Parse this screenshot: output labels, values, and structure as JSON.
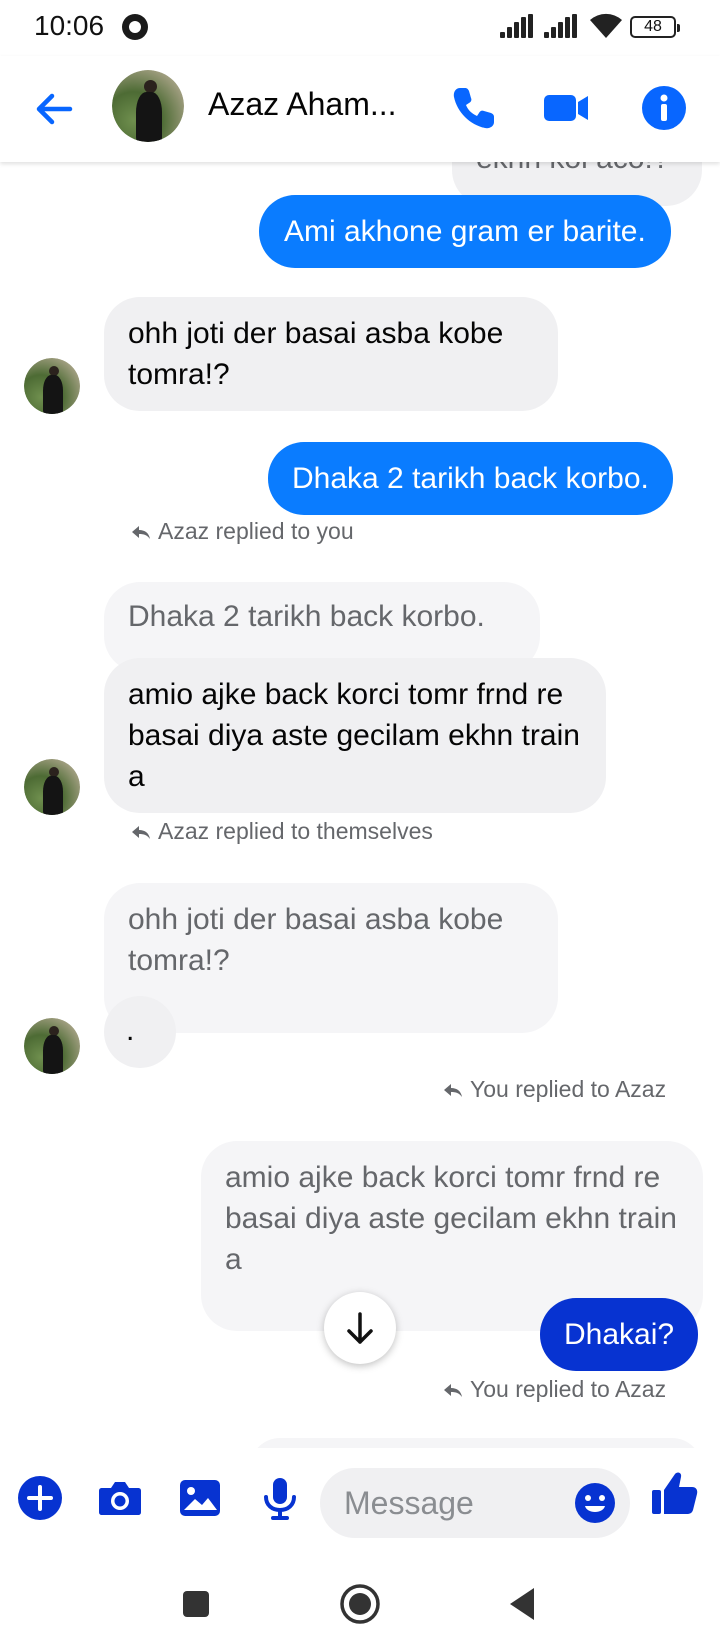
{
  "status_bar": {
    "time": "10:06",
    "battery": "48"
  },
  "header": {
    "contact_name": "Azaz Aham..."
  },
  "chat": {
    "partial_top_text": "ekhn koi aco!?",
    "messages": {
      "m1": "Ami akhone gram er barite.",
      "m2": "ohh joti der basai asba kobe tomra!?",
      "m3": "Dhaka 2 tarikh back korbo.",
      "r1_label": "Azaz replied to you",
      "r1_quote": "Dhaka 2 tarikh back korbo.",
      "r1_text": "amio ajke back korci tomr frnd re basai diya aste gecilam ekhn train a",
      "r2_label": "Azaz replied to themselves",
      "r2_quote": "ohh joti der basai asba kobe tomra!?",
      "r2_text": ".",
      "r3_label": "You replied to Azaz",
      "r3_quote": "amio ajke back korci tomr frnd re basai diya aste gecilam ekhn train a",
      "r3_text": "Dhakai?",
      "r4_label": "You replied to Azaz"
    }
  },
  "composer": {
    "placeholder": "Message"
  },
  "colors": {
    "accent": "#0a7cff",
    "accent_dark": "#0733d1",
    "icon_blue": "#0866ff"
  }
}
